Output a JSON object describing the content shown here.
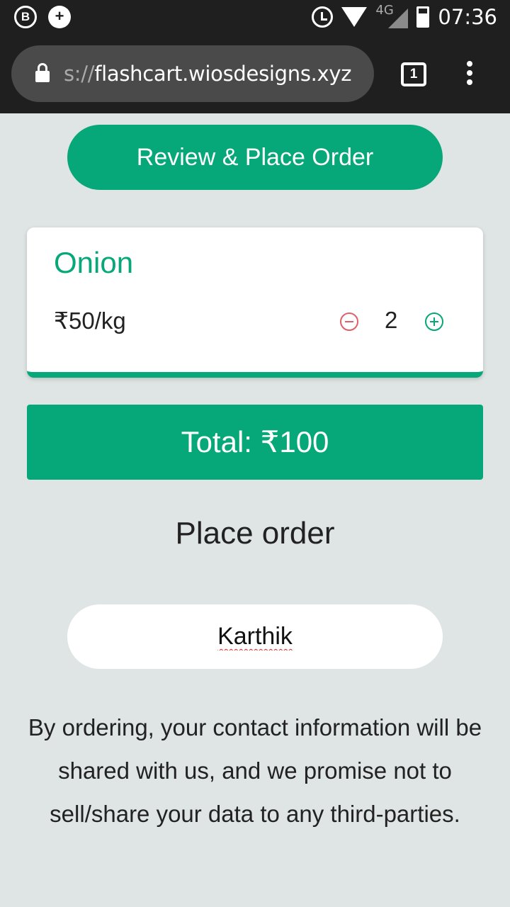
{
  "status_bar": {
    "icons": [
      "b-icon",
      "plus-icon",
      "alarm-icon",
      "wifi-icon",
      "signal-icon",
      "battery-icon"
    ],
    "network": "4G",
    "time": "07:36"
  },
  "browser": {
    "url_scheme": "s://",
    "url_host": "flashcart.wiosdesigns.xyz",
    "tab_count": "1"
  },
  "main": {
    "review_button": "Review & Place Order",
    "cart_item": {
      "name": "Onion",
      "price": "₹50/kg",
      "quantity": "2"
    },
    "total": "Total: ₹100",
    "place_order_heading": "Place order",
    "name_input_value": "Karthik",
    "disclaimer": "By ordering, your contact information will be shared with us, and we promise not to sell/share your data to any third-parties."
  },
  "colors": {
    "accent": "#06a778",
    "minus": "#e0606a",
    "background": "#dfe5e4",
    "chrome": "#1f1f1f"
  }
}
